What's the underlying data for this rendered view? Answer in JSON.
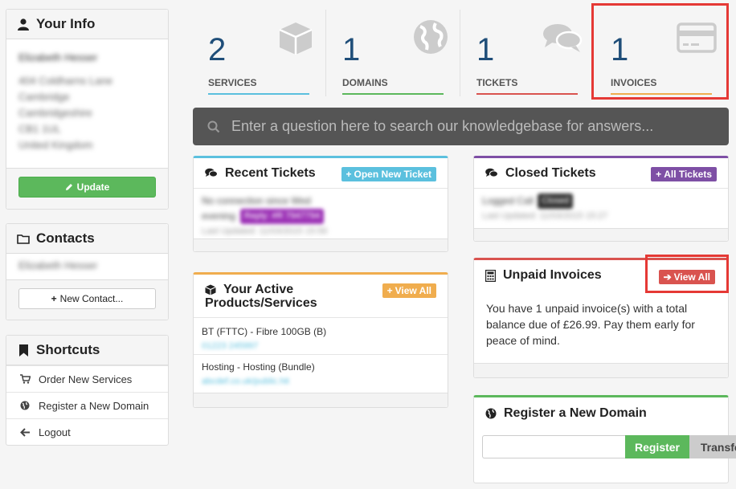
{
  "sidebar": {
    "your_info": {
      "title": "Your Info",
      "name": "Elizabeth Hesser",
      "address": [
        "404 Coldharns Lane",
        "Cambridge",
        "Cambridgeshire",
        "CB1 1UL",
        "United Kingdom"
      ],
      "update_label": "Update"
    },
    "contacts": {
      "title": "Contacts",
      "contact": "Elizabeth Hesser",
      "new_contact_label": "New Contact..."
    },
    "shortcuts": {
      "title": "Shortcuts",
      "items": [
        {
          "label": "Order New Services",
          "icon": "cart-icon"
        },
        {
          "label": "Register a New Domain",
          "icon": "globe-icon"
        },
        {
          "label": "Logout",
          "icon": "arrow-left-icon"
        }
      ]
    }
  },
  "stats": [
    {
      "count": "2",
      "label": "SERVICES",
      "icon": "cube-icon",
      "color": "#5bc0de"
    },
    {
      "count": "1",
      "label": "DOMAINS",
      "icon": "globe-icon",
      "color": "#5cb85c"
    },
    {
      "count": "1",
      "label": "TICKETS",
      "icon": "comments-icon",
      "color": "#d9534f"
    },
    {
      "count": "1",
      "label": "INVOICES",
      "icon": "credit-card-icon",
      "color": "#f0ad4e"
    }
  ],
  "search": {
    "placeholder": "Enter a question here to search our knowledgebase for answers..."
  },
  "recent_tickets": {
    "title": "Recent Tickets",
    "button": "Open New Ticket",
    "ticket_subject": "No connection since Wed",
    "ticket_subject_2": "evening",
    "ticket_status": "Reply: #R 7947794",
    "ticket_updated": "Last Updated: 11/03/2015 15:56"
  },
  "closed_tickets": {
    "title": "Closed Tickets",
    "button": "All Tickets",
    "ticket_subject": "Logged Call",
    "ticket_status": "Closed",
    "ticket_updated": "Last Updated: 11/03/2015 15:27"
  },
  "active_products": {
    "title_line1": "Your Active",
    "title_line2": "Products/Services",
    "button": "View All",
    "items": [
      {
        "name": "BT (FTTC) - Fibre 100GB (B)",
        "detail": "01223 245997"
      },
      {
        "name": "Hosting - Hosting (Bundle)",
        "detail": "abcdef.co.uk/public.hit"
      }
    ]
  },
  "unpaid_invoices": {
    "title": "Unpaid Invoices",
    "button": "View All",
    "message": "You have 1 unpaid invoice(s) with a total balance due of £26.99. Pay them early for peace of mind."
  },
  "register_domain": {
    "title": "Register a New Domain",
    "input_value": "",
    "register_label": "Register",
    "transfer_label": "Transfer"
  },
  "colors": {
    "blue": "#5bc0de",
    "purple": "#7e4fa5",
    "orange": "#f0ad4e",
    "red": "#d9534f",
    "green": "#5cb85c",
    "highlight": "#e53935"
  }
}
